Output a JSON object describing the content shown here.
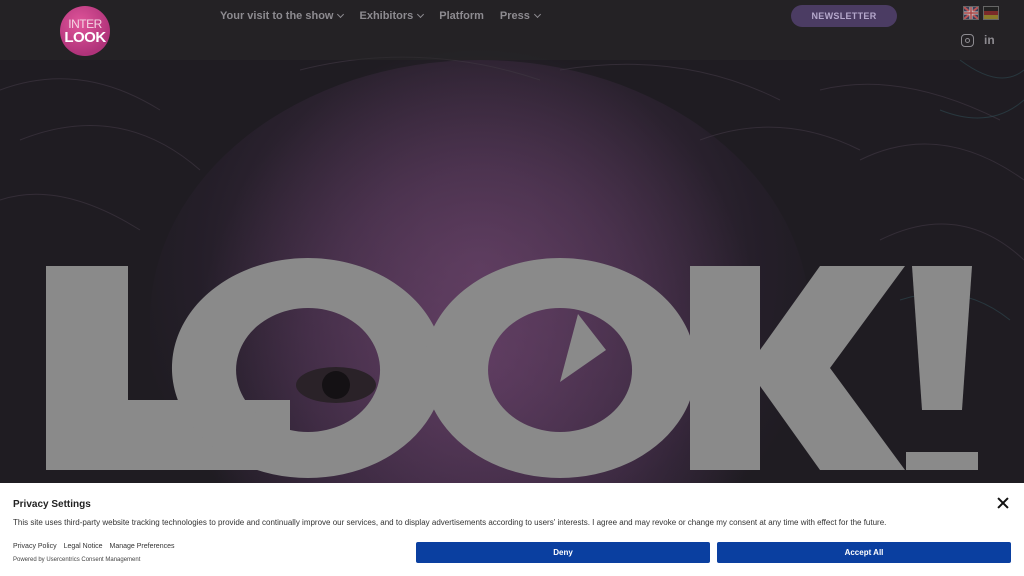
{
  "header": {
    "logo": {
      "line1": "INTER",
      "line2": "LOOK"
    },
    "nav": [
      {
        "label": "Your visit to the show",
        "has_dropdown": true
      },
      {
        "label": "Exhibitors",
        "has_dropdown": true
      },
      {
        "label": "Platform",
        "has_dropdown": false
      },
      {
        "label": "Press",
        "has_dropdown": true
      }
    ],
    "newsletter_label": "NEWSLETTER",
    "languages": [
      "en-flag-icon",
      "de-flag-icon"
    ],
    "social": [
      "instagram-icon",
      "linkedin-icon"
    ]
  },
  "hero": {
    "headline": "LOOK!"
  },
  "cookie_banner": {
    "title": "Privacy Settings",
    "text": "This site uses third-party website tracking technologies to provide and continually improve our services, and to display advertisements according to users' interests. I agree and may revoke or change my consent at any time with effect for the future.",
    "links": [
      "Privacy Policy",
      "Legal Notice",
      "Manage Preferences"
    ],
    "powered_by": "Powered by Usercentrics Consent Management",
    "deny_label": "Deny",
    "accept_label": "Accept All"
  },
  "colors": {
    "accent_button": "#0a3fa0",
    "newsletter_bg": "#4b3c63",
    "logo_pink": "#c83f88",
    "headline_gray": "#8a8a8a"
  }
}
